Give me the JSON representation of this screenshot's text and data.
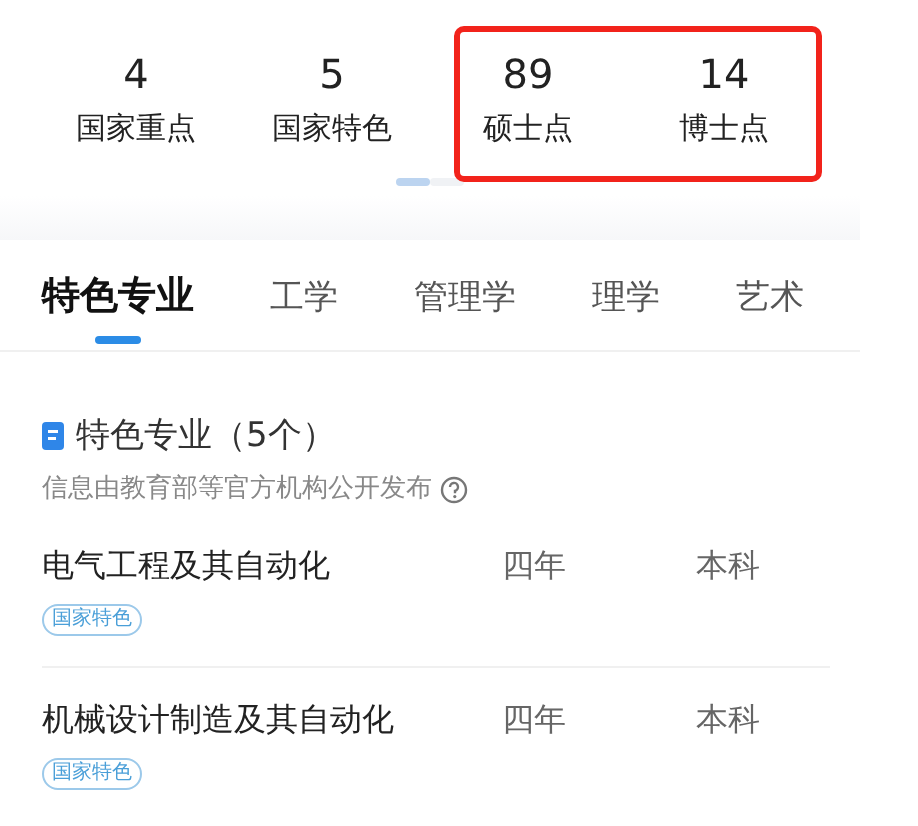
{
  "stats": [
    {
      "value": "4",
      "label": "国家重点"
    },
    {
      "value": "5",
      "label": "国家特色"
    },
    {
      "value": "89",
      "label": "硕士点"
    },
    {
      "value": "14",
      "label": "博士点"
    }
  ],
  "pager": [
    {
      "selected": true
    },
    {
      "selected": false
    }
  ],
  "tabs": [
    {
      "label": "特色专业",
      "selected": true
    },
    {
      "label": "工学",
      "selected": false
    },
    {
      "label": "管理学",
      "selected": false
    },
    {
      "label": "理学",
      "selected": false
    },
    {
      "label": "艺术",
      "selected": false
    }
  ],
  "section": {
    "title": "特色专业（5个）",
    "note": "信息由教育部等官方机构公开发布"
  },
  "rows": [
    {
      "name": "电气工程及其自动化",
      "duration": "四年",
      "level": "本科",
      "tag": "国家特色"
    },
    {
      "name": "机械设计制造及其自动化",
      "duration": "四年",
      "level": "本科",
      "tag": "国家特色"
    }
  ]
}
